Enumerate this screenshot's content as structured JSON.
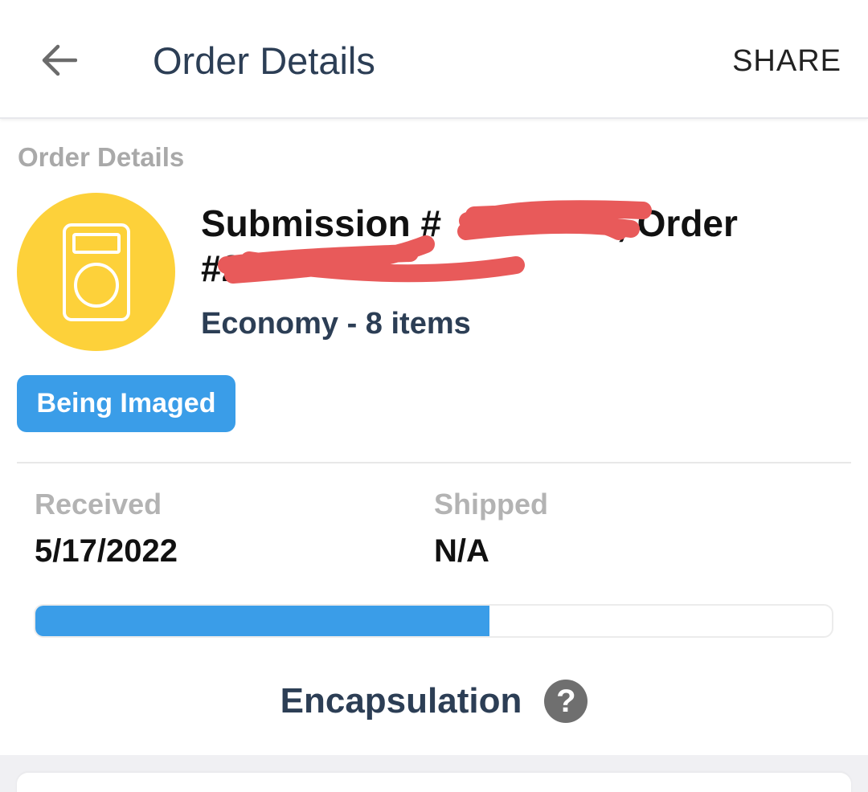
{
  "header": {
    "back_icon": "arrow-left-icon",
    "title": "Order Details",
    "share_label": "SHARE"
  },
  "section_label": "Order Details",
  "order": {
    "icon": "card-slab-icon",
    "title_part1": "Submission #",
    "title_part2": ", Order",
    "title_part3": "#2",
    "service_line": "Economy - 8 items",
    "status": "Being Imaged"
  },
  "dates": {
    "received_label": "Received",
    "received_value": "5/17/2022",
    "shipped_label": "Shipped",
    "shipped_value": "N/A"
  },
  "progress": {
    "fraction": 0.57
  },
  "encapsulation": {
    "label": "Encapsulation",
    "help_glyph": "?"
  },
  "colors": {
    "accent": "#3a9de8",
    "avatar": "#fdd13a",
    "title_text": "#2c3e55",
    "redaction": "#e85a5a"
  }
}
